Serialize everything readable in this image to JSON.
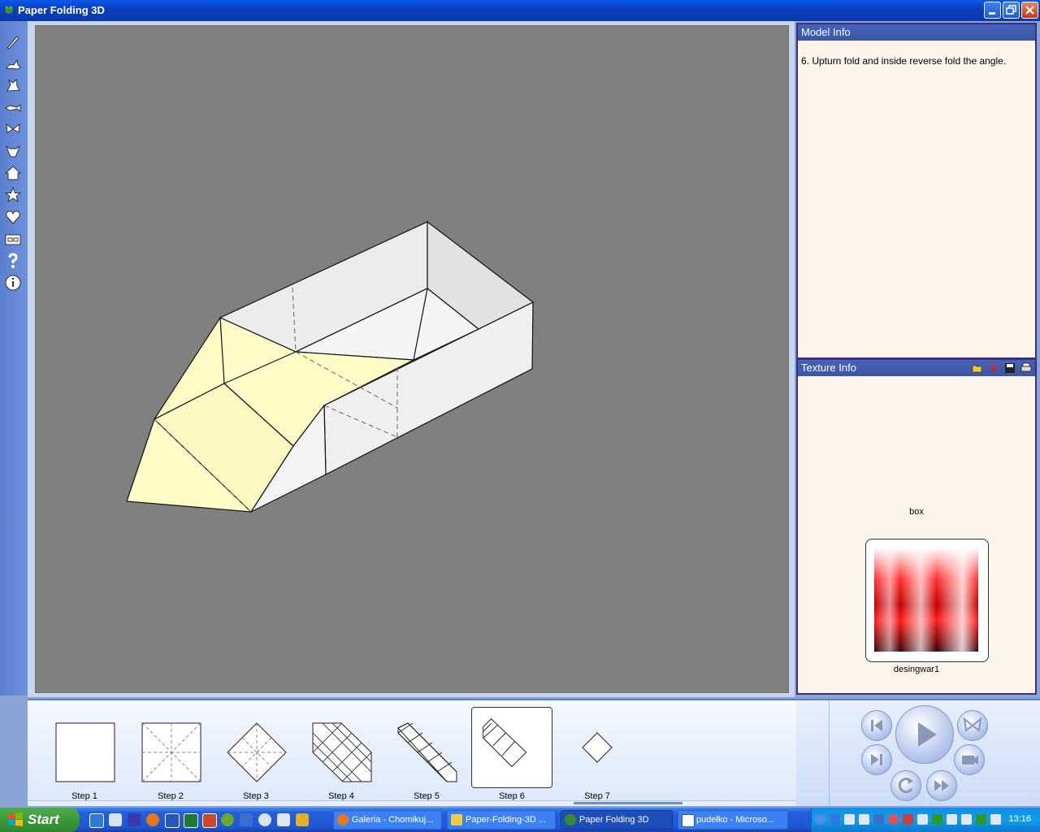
{
  "window": {
    "title": "Paper Folding 3D"
  },
  "model_info": {
    "header": "Model Info",
    "text": "6.  Upturn fold and inside reverse fold the angle."
  },
  "texture_info": {
    "header": "Texture Info",
    "texture_name": "box",
    "image_caption": "desingwar1"
  },
  "steps": [
    {
      "label": "Step 1"
    },
    {
      "label": "Step 2"
    },
    {
      "label": "Step 3"
    },
    {
      "label": "Step 4"
    },
    {
      "label": "Step 5"
    },
    {
      "label": "Step 6",
      "selected": true
    },
    {
      "label": "Step 7"
    }
  ],
  "toolbar_icons": [
    "pen-icon",
    "rabbit-icon",
    "rooster-icon",
    "fish-icon",
    "butterfly-icon",
    "bull-icon",
    "house-icon",
    "star-icon",
    "heart-icon",
    "box-icon",
    "help-icon",
    "info-icon"
  ],
  "taskbar": {
    "start_label": "Start",
    "tasks": [
      {
        "label": "Galeria - Chomikuj..."
      },
      {
        "label": "Paper-Folding-3D ..."
      },
      {
        "label": "Paper Folding 3D",
        "active": true
      },
      {
        "label": "pudełko - Microso..."
      }
    ],
    "clock": "13:16"
  },
  "colors": {
    "viewport_bg": "#808080",
    "paper_inside": "#fffcc7",
    "paper_outside": "#eeeeee",
    "panel_header": "#3b56a6",
    "panel_bg": "#fdf4ec"
  }
}
